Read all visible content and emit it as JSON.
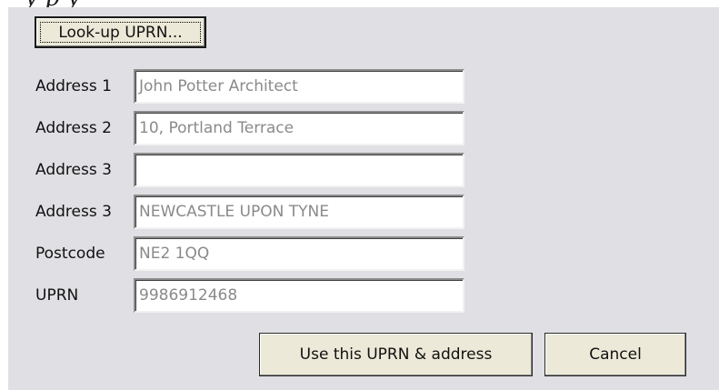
{
  "caption_fragment": "y                                                    p            y",
  "dialog": {
    "lookup_button": "Look-up UPRN...",
    "rows": [
      {
        "label": "Address 1",
        "value": "John Potter Architect"
      },
      {
        "label": "Address 2",
        "value": "10, Portland Terrace"
      },
      {
        "label": "Address 3",
        "value": ""
      },
      {
        "label": "Address 3",
        "value": "NEWCASTLE UPON TYNE"
      },
      {
        "label": "Postcode",
        "value": "NE2 1QQ"
      },
      {
        "label": "UPRN",
        "value": "9986912468"
      }
    ],
    "use_button": "Use this UPRN & address",
    "cancel_button": "Cancel"
  }
}
